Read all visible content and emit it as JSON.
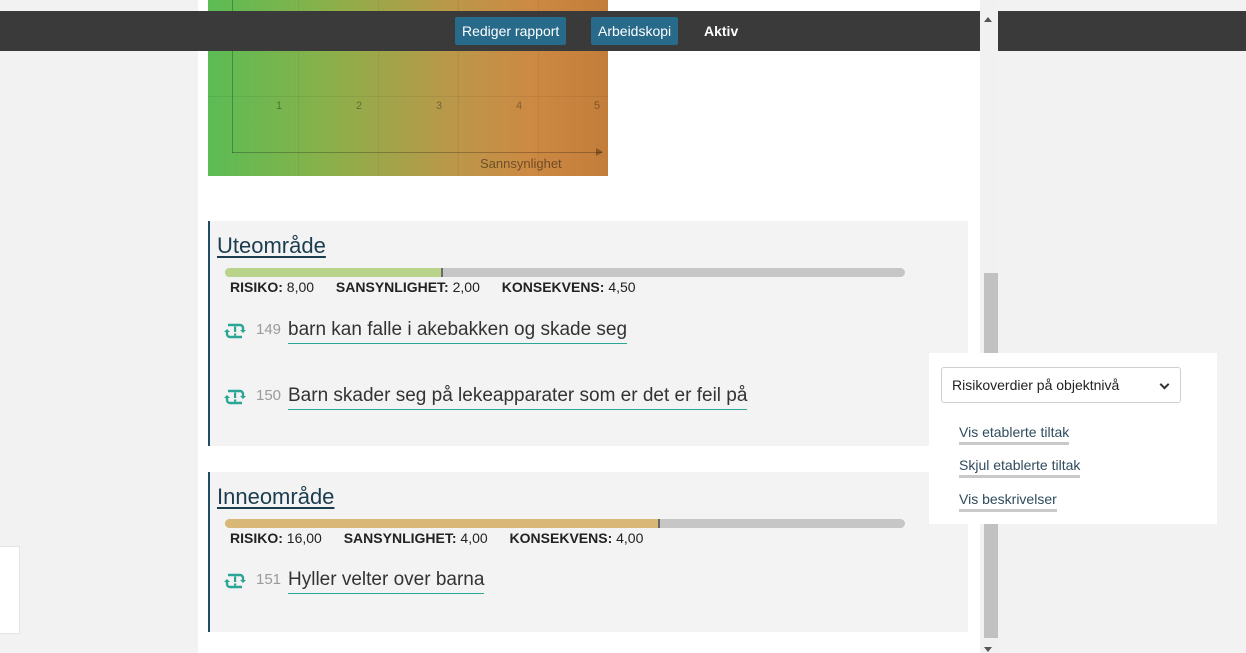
{
  "topbar": {
    "edit_report": "Rediger rapport",
    "working_copy": "Arbeidskopi",
    "status": "Aktiv"
  },
  "matrix": {
    "x_ticks": [
      "1",
      "2",
      "3",
      "4",
      "5"
    ],
    "x_label": "Sannsynlighet"
  },
  "sections": [
    {
      "title": "Uteområde",
      "risk_fraction": 0.32,
      "bar_color": "#b9d48a",
      "risiko_label": "RISIKO:",
      "risiko_value": "8,00",
      "sannsynlighet_label": "SANSYNLIGHET:",
      "sannsynlighet_value": "2,00",
      "konsekvens_label": "KONSEKVENS:",
      "konsekvens_value": "4,50",
      "items": [
        {
          "number": "149",
          "text": "barn kan falle i akebakken og skade seg"
        },
        {
          "number": "150",
          "text": "Barn skader seg på lekeapparater som er det er feil på"
        }
      ]
    },
    {
      "title": "Inneområde",
      "risk_fraction": 0.64,
      "bar_color": "#d9b877",
      "risiko_label": "RISIKO:",
      "risiko_value": "16,00",
      "sannsynlighet_label": "SANSYNLIGHET:",
      "sannsynlighet_value": "4,00",
      "konsekvens_label": "KONSEKVENS:",
      "konsekvens_value": "4,00",
      "items": [
        {
          "number": "151",
          "text": "Hyller velter over barna"
        }
      ]
    }
  ],
  "side_panel": {
    "select_value": "Risikoverdier på objektnivå",
    "links": [
      "Vis etablerte tiltak",
      "Skjul etablerte tiltak",
      "Vis beskrivelser"
    ]
  },
  "colors": {
    "accent": "#276a8a",
    "icon_green": "#2ba696",
    "section_border": "#1f4d66"
  },
  "icons": {
    "risk_item": "risk-cycle-icon",
    "select_chevron": "chevron-down-icon"
  }
}
